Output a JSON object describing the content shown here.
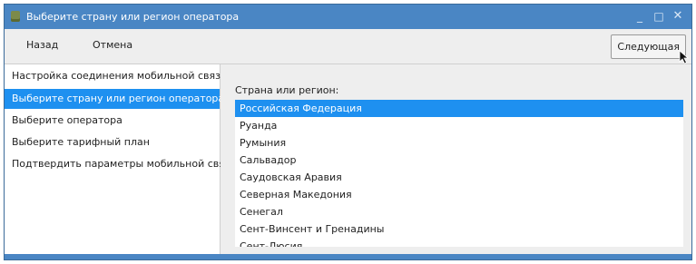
{
  "window": {
    "title": "Выберите страну или регион оператора",
    "controls": {
      "minimize": "_",
      "maximize": "□",
      "close": "✕"
    },
    "accent": "#4a86c4"
  },
  "toolbar": {
    "back_label": "Назад",
    "cancel_label": "Отмена",
    "next_label": "Следующая"
  },
  "sidebar": {
    "items": [
      {
        "label": "Настройка соединения мобильной связи",
        "active": false
      },
      {
        "label": "Выберите страну или регион оператора",
        "active": true
      },
      {
        "label": "Выберите оператора",
        "active": false
      },
      {
        "label": "Выберите тарифный план",
        "active": false
      },
      {
        "label": "Подтвердить параметры мобильной связи",
        "active": false
      }
    ],
    "active_color": "#1e90f0"
  },
  "main": {
    "list_label": "Страна или регион:",
    "countries": [
      {
        "label": "Российская Федерация",
        "selected": true
      },
      {
        "label": "Руанда",
        "selected": false
      },
      {
        "label": "Румыния",
        "selected": false
      },
      {
        "label": "Сальвадор",
        "selected": false
      },
      {
        "label": "Саудовская Аравия",
        "selected": false
      },
      {
        "label": "Северная Македония",
        "selected": false
      },
      {
        "label": "Сенегал",
        "selected": false
      },
      {
        "label": "Сент-Винсент и Гренадины",
        "selected": false
      },
      {
        "label": "Сент-Люсия",
        "selected": false
      }
    ]
  }
}
